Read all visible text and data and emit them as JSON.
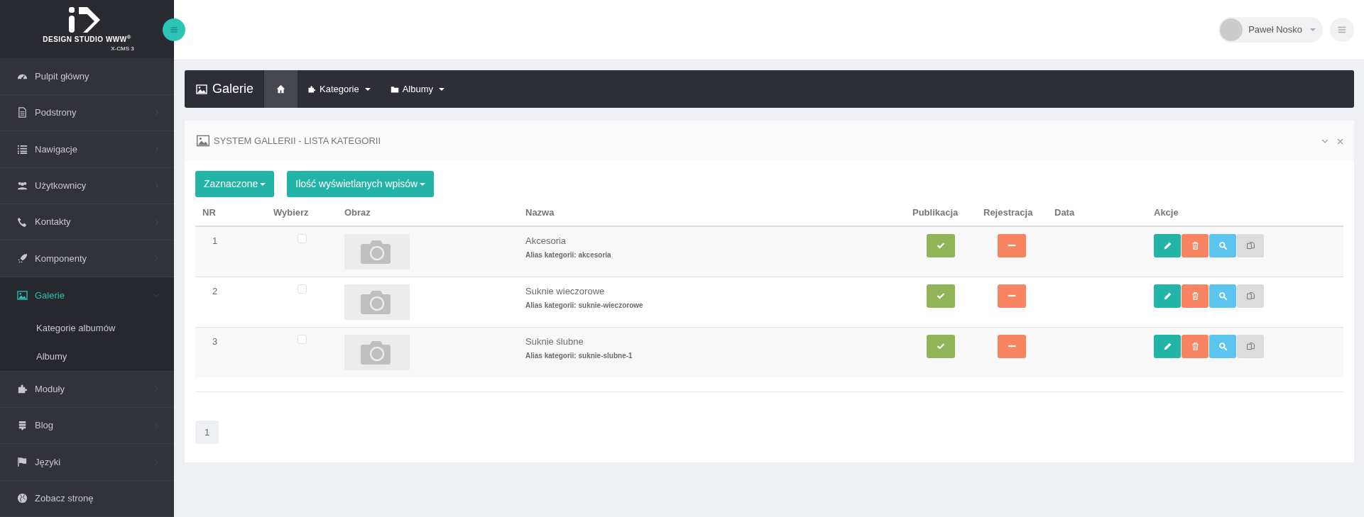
{
  "logo": {
    "title": "DESIGN STUDIO WWW$^{®}$",
    "subtitle": "X-CMS 3"
  },
  "sidebar": {
    "items": [
      {
        "label": "Pulpit główny",
        "selected": false,
        "expanded": false,
        "has_arrow": false
      },
      {
        "label": "Podstrony",
        "selected": false,
        "expanded": false,
        "has_arrow": true
      },
      {
        "label": "Nawigacje",
        "selected": false,
        "expanded": false,
        "has_arrow": true
      },
      {
        "label": "Użytkownicy",
        "selected": false,
        "expanded": false,
        "has_arrow": true
      },
      {
        "label": "Kontakty",
        "selected": false,
        "expanded": false,
        "has_arrow": true
      },
      {
        "label": "Komponenty",
        "selected": false,
        "expanded": false,
        "has_arrow": true
      },
      {
        "label": "Galerie",
        "selected": true,
        "expanded": true,
        "has_arrow": true,
        "children": [
          {
            "label": "Kategorie albumów"
          },
          {
            "label": "Albumy"
          }
        ]
      },
      {
        "label": "Moduły",
        "selected": false,
        "expanded": false,
        "has_arrow": true
      },
      {
        "label": "Blog",
        "selected": false,
        "expanded": false,
        "has_arrow": true
      },
      {
        "label": "Języki",
        "selected": false,
        "expanded": false,
        "has_arrow": true
      },
      {
        "label": "Zobacz stronę",
        "selected": false,
        "expanded": false,
        "has_arrow": false
      }
    ]
  },
  "topbar": {
    "user": "Paweł Nosko"
  },
  "page_header": {
    "title": "Galerie",
    "nav": [
      {
        "kind": "home",
        "selected": true
      },
      {
        "kind": "menu",
        "label": "Kategorie",
        "selected": false
      },
      {
        "kind": "menu",
        "label": "Albumy",
        "selected": false
      }
    ]
  },
  "panel": {
    "title": "SYSTEM GALLERII - LISTA KATEGORII",
    "buttons": [
      "Zaznaczone",
      "Ilość wyświetlanych wpisów"
    ],
    "table": {
      "columns": [
        "NR",
        "Wybierz",
        "Obraz",
        "Nazwa",
        "Publikacja",
        "Rejestracja",
        "Data",
        "Akcje"
      ],
      "rows": [
        {
          "nr": "1",
          "checked": false,
          "name": "Akcesoria",
          "alias": "Alias kategorii: akcesoria",
          "published": true,
          "registered": false
        },
        {
          "nr": "2",
          "checked": false,
          "name": "Suknie wieczorowe",
          "alias": "Alias kategorii: suknie-wieczorowe",
          "published": true,
          "registered": false
        },
        {
          "nr": "3",
          "checked": false,
          "name": "Suknie ślubne",
          "alias": "Alias kategorii: suknie-slubne-1",
          "published": true,
          "registered": false
        }
      ]
    },
    "pagination": [
      {
        "label": "1",
        "selected": true
      }
    ]
  }
}
